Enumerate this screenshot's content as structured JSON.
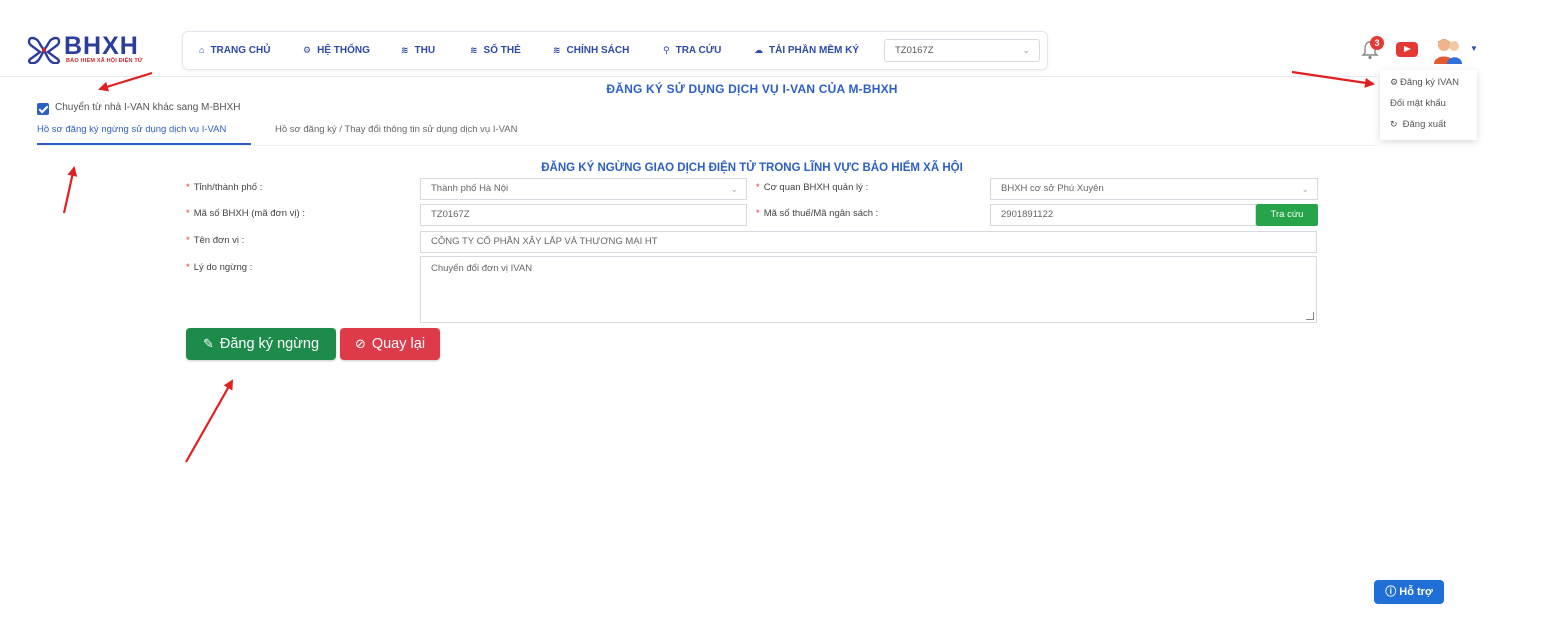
{
  "logo": {
    "text": "BHXH",
    "subtitle": "BẢO HIỂM XÃ HỘI ĐIỆN TỬ"
  },
  "nav": {
    "items": [
      {
        "label": "TRANG CHỦ",
        "icon": "home-icon"
      },
      {
        "label": "HỆ THỐNG",
        "icon": "gear-icon"
      },
      {
        "label": "THU",
        "icon": "money-icon"
      },
      {
        "label": "SỐ THẺ",
        "icon": "card-icon"
      },
      {
        "label": "CHÍNH SÁCH",
        "icon": "policy-icon"
      },
      {
        "label": "TRA CỨU",
        "icon": "search-icon"
      },
      {
        "label": "TẢI PHẦN MỀM KÝ",
        "icon": "cloud-download-icon"
      }
    ],
    "unit_select": "TZ0167Z"
  },
  "header": {
    "notification_count": "3"
  },
  "user_menu": {
    "items": [
      {
        "label": "Đăng ký IVAN",
        "icon": "gear-icon"
      },
      {
        "label": "Đổi mật khẩu",
        "icon": ""
      },
      {
        "label": "Đăng xuất",
        "icon": "logout-icon"
      }
    ]
  },
  "page": {
    "title": "ĐĂNG KÝ SỬ DỤNG DỊCH VỤ I-VAN CỦA M-BHXH",
    "checkbox_label": "Chuyển từ nhà I-VAN khác sang M-BHXH",
    "checkbox_checked": true,
    "tabs": [
      {
        "label": "Hồ sơ đăng ký ngừng sử dụng dịch vụ I-VAN",
        "active": true
      },
      {
        "label": "Hồ sơ đăng ký / Thay đổi thông tin sử dụng dịch vụ I-VAN",
        "active": false
      }
    ],
    "section_title": "ĐĂNG KÝ NGỪNG GIAO DỊCH ĐIỆN TỬ TRONG LĨNH VỰC BẢO HIỂM XÃ HỘI"
  },
  "form": {
    "province_label": "Tỉnh/thành phố :",
    "province_value": "Thành phố Hà Nội",
    "agency_label": "Cơ quan BHXH quản lý :",
    "agency_value": "BHXH cơ sở Phú Xuyên",
    "unit_code_label": "Mã số BHXH (mã đơn vị) :",
    "unit_code_value": "TZ0167Z",
    "tax_code_label": "Mã số thuế/Mã ngân sách :",
    "tax_code_value": "2901891122",
    "lookup_button": "Tra cứu",
    "unit_name_label": "Tên đơn vị :",
    "unit_name_value": "CÔNG TY CỔ PHẦN XÂY LẮP VÀ THƯƠNG MẠI HT",
    "reason_label": "Lý do ngừng :",
    "reason_value": "Chuyển đổi đơn vị IVAN",
    "required_mark": "*"
  },
  "actions": {
    "register_button": "Đăng ký ngừng",
    "back_button": "Quay lại"
  },
  "help_button": "Hỗ trợ",
  "colors": {
    "primary": "#2c5fc4",
    "nav_text": "#2c4aa8",
    "register": "#1d8c4a",
    "back": "#dd3b4a",
    "lookup": "#27a34a",
    "annotation_arrow": "#e02020"
  }
}
